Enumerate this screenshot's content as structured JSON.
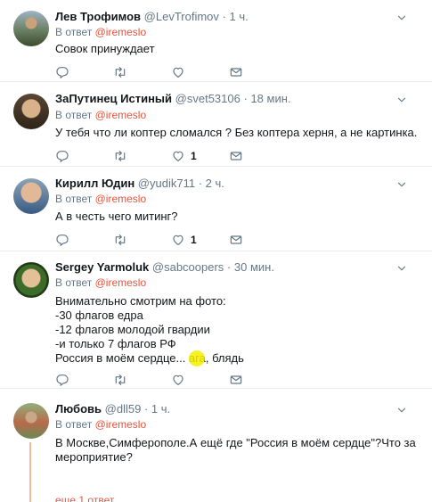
{
  "tweets": [
    {
      "name": "Лев Трофимов",
      "handle": "@LevTrofimov",
      "dot": "·",
      "time": "1 ч.",
      "reply_prefix": "В ответ",
      "reply_to": "@iremeslo",
      "lines": [
        "Совок принуждает"
      ],
      "retweet_count": "",
      "like_count": ""
    },
    {
      "name": "ЗаПутинец Истиный",
      "handle": "@svet53106",
      "dot": "·",
      "time": "18 мин.",
      "reply_prefix": "В ответ",
      "reply_to": "@iremeslo",
      "lines": [
        "У тебя что ли коптер сломался ? Без коптера херня, а не картинка."
      ],
      "retweet_count": "",
      "like_count": "1"
    },
    {
      "name": "Кирилл Юдин",
      "handle": "@yudik711",
      "dot": "·",
      "time": "2 ч.",
      "reply_prefix": "В ответ",
      "reply_to": "@iremeslo",
      "lines": [
        "А в честь чего митинг?"
      ],
      "retweet_count": "",
      "like_count": "1"
    },
    {
      "name": "Sergey Yarmoluk",
      "handle": "@sabcoopers",
      "dot": "·",
      "time": "30 мин.",
      "reply_prefix": "В ответ",
      "reply_to": "@iremeslo",
      "lines": [
        "Внимательно смотрим на фото:",
        "-30 флагов едра",
        "-12 флагов молодой гвардии",
        "-и только 7 флагов РФ",
        "Россия в моём сердце... ага, блядь"
      ],
      "retweet_count": "",
      "like_count": ""
    },
    {
      "name": "Любовь",
      "handle": "@dll59",
      "dot": "·",
      "time": "1 ч.",
      "reply_prefix": "В ответ",
      "reply_to": "@iremeslo",
      "lines": [
        "В Москве,Симферополе.А ещё где \"Россия в моём сердце\"?Что за",
        "мероприятие?"
      ],
      "retweet_count": "",
      "like_count": ""
    }
  ],
  "more_replies": "еще 1 ответ",
  "icons": {
    "reply": "reply-icon",
    "retweet": "retweet-icon",
    "like": "heart-icon",
    "dm": "envelope-icon",
    "menu": "chevron-down-icon"
  },
  "colors": {
    "link": "#e8563f",
    "muted": "#657786",
    "text": "#14171a",
    "divider": "#e6ecf0",
    "thread": "#f5b7a1"
  }
}
